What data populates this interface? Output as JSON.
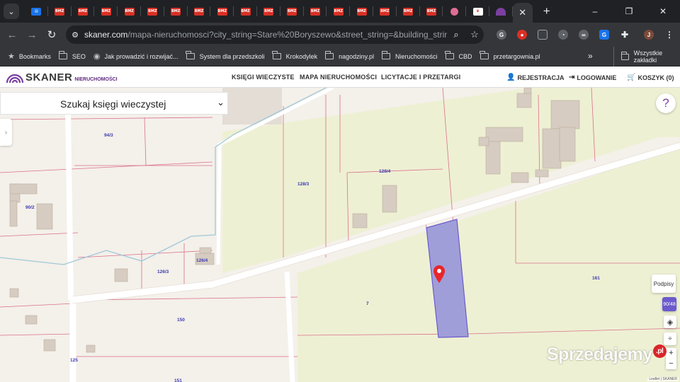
{
  "browser": {
    "tab_favicons": [
      "BMZ",
      "BMZ",
      "BMZ",
      "BMZ",
      "BMZ",
      "BMZ",
      "BMZ",
      "BMZ",
      "BMZ",
      "BMZ",
      "BMZ",
      "BMZ",
      "BMZ",
      "BMZ",
      "BMZ",
      "BMZ",
      "BMZ",
      "BMZ",
      "BMZ"
    ],
    "new_tab": "+",
    "window_controls": [
      "–",
      "❐",
      "✕"
    ],
    "url_host": "skaner.com",
    "url_path": "/mapa-nieruchomosci?city_string=Stare%20Boryszewo&street_string=&building_string=&r...",
    "bookmarks": [
      {
        "label": "Bookmarks",
        "icon": "star-icon"
      },
      {
        "label": "SEO",
        "icon": "folder-icon"
      },
      {
        "label": "Jak prowadzić i rozwijać...",
        "icon": "globe-icon"
      },
      {
        "label": "System dla przedszkoli",
        "icon": "folder-icon"
      },
      {
        "label": "Krokodylek",
        "icon": "folder-icon"
      },
      {
        "label": "nagodziny.pl",
        "icon": "folder-icon"
      },
      {
        "label": "Nieruchomości",
        "icon": "folder-icon"
      },
      {
        "label": "CBD",
        "icon": "folder-icon"
      },
      {
        "label": "przetargownia.pl",
        "icon": "folder-icon"
      }
    ],
    "bookmarks_more": "»",
    "bookmarks_all": "Wszystkie zakładki",
    "profile_initial": "J"
  },
  "site": {
    "logo_text": "SKANER",
    "logo_sub": "NIERUCHOMOŚCI",
    "nav": [
      "KSIĘGI WIECZYSTE",
      "MAPA NIERUCHOMOŚCI",
      "LICYTACJE I PRZETARGI"
    ],
    "register": "REJESTRACJA",
    "login": "LOGOWANIE",
    "cart": "KOSZYK (0)"
  },
  "map": {
    "search_label": "Szukaj księgi wieczystej",
    "help": "?",
    "podpisy": "Podpisy",
    "ctrl_label": "90/48",
    "zoom_in": "+",
    "zoom_out": "−",
    "attribution": "Leaflet | SKANER",
    "watermark": "Sprzedajemy",
    "watermark_badge": ".pl",
    "parcels": [
      "94/3",
      "128/3",
      "128/4",
      "90/2",
      "126/4",
      "126/3",
      "150",
      "161",
      "7",
      "125",
      "151"
    ]
  },
  "colors": {
    "map_bg": "#f4f0ea",
    "field_green": "#eef0d3",
    "building": "#d7ccc1",
    "parcel_line": "#d9708b",
    "road": "#ffffff",
    "highlight": "#9f9ed8",
    "pin": "#e8262b",
    "label": "#3b3ab0",
    "brand": "#7b3fa0"
  }
}
